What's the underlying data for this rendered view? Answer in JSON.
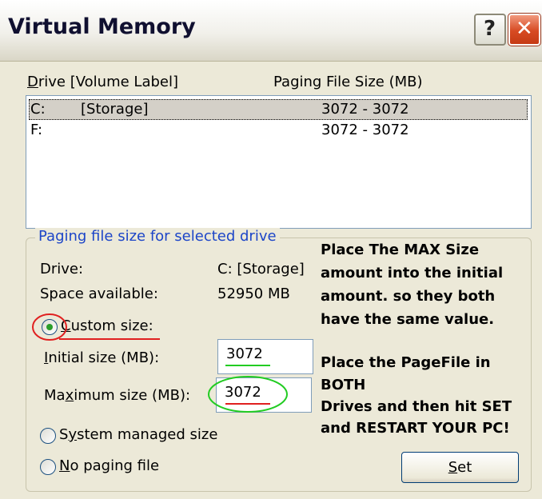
{
  "window": {
    "title": "Virtual Memory",
    "help_glyph": "?",
    "close_glyph": "✕"
  },
  "list": {
    "header_drive_prefix": "D",
    "header_drive_rest": "rive  [Volume Label]",
    "header_size": "Paging File Size (MB)",
    "rows": [
      {
        "drive": "C:",
        "label": "[Storage]",
        "size": "3072 - 3072"
      },
      {
        "drive": "F:",
        "label": "",
        "size": "3072 - 3072"
      }
    ]
  },
  "group": {
    "legend": "Paging file size for selected drive",
    "drive_label": "Drive:",
    "drive_value": "C:  [Storage]",
    "space_label": "Space available:",
    "space_value": "52950 MB",
    "custom_prefix": "C",
    "custom_rest": "ustom size:",
    "initial_prefix": "I",
    "initial_rest": "nitial size (MB):",
    "initial_value": "3072",
    "max_pre": "Ma",
    "max_u": "x",
    "max_rest": "imum size (MB):",
    "max_value": "3072",
    "system_pre": "S",
    "system_u": "y",
    "system_rest": "stem managed size",
    "nopaging_prefix": "N",
    "nopaging_rest": "o paging file",
    "set_prefix": "S",
    "set_rest": "et"
  },
  "note": {
    "line1": "Place The MAX Size",
    "line2": "amount into the initial",
    "line3": "amount. so they both",
    "line4": "have the same value.",
    "line5": "Place the PageFile in",
    "line6": "BOTH",
    "line7": "Drives and then hit SET",
    "line8": "and RESTART YOUR PC!"
  },
  "state": {
    "selected_option": "custom",
    "selected_drive": "C:"
  },
  "colors": {
    "annotation_red": "#e02020",
    "annotation_green": "#22cc22",
    "legend_blue": "#1c45c8"
  }
}
